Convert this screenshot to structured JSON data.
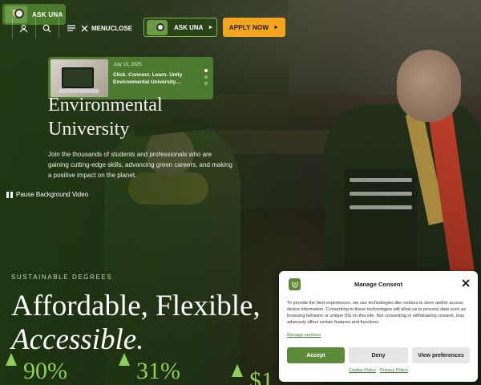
{
  "header": {
    "logo_label": "ASK UNA",
    "menu_label": "MENU",
    "close_label": "CLOSE",
    "ask_label": "ASK UNA",
    "ask_arrow": "►",
    "apply_label": "APPLY NOW",
    "apply_arrow": "►"
  },
  "icons": {
    "user": "user-icon",
    "search": "search-icon",
    "menu": "menu-icon",
    "close": "close-icon",
    "pause": "pause-icon",
    "tree": "tree-icon"
  },
  "news": {
    "date": "July 10, 2025",
    "title": "Click. Connect. Learn. Unity Environmental University…",
    "slide_count": 3,
    "active_slide": 1
  },
  "hero": {
    "title_line1": "Environmental",
    "title_line2": "University",
    "description": "Join the thousands of students and professionals who are gaining cutting-edge skills, advancing green careers, and making a positive impact on the planet.",
    "pause_label": "Pause Background Video"
  },
  "degrees": {
    "kicker": "SUSTAINABLE DEGREES",
    "line1": "Affordable, Flexible,",
    "line2": "Accessible.",
    "stats": [
      "90%",
      "31%",
      "$1"
    ]
  },
  "consent": {
    "title": "Manage Consent",
    "body": "To provide the best experiences, we use technologies like cookies to store and/or access device information. Consenting to these technologies will allow us to process data such as browsing behavior or unique IDs on this site. Not consenting or withdrawing consent, may adversely affect certain features and functions.",
    "manage_services": "Manage services",
    "accept": "Accept",
    "deny": "Deny",
    "preferences": "View preferences",
    "cookie_policy": "Cookie Policy",
    "privacy_policy": "Privacy Policy"
  },
  "colors": {
    "brand_green": "#4c7a2e",
    "accent_orange": "#f3a51e",
    "stat_green": "#8fce5a"
  }
}
